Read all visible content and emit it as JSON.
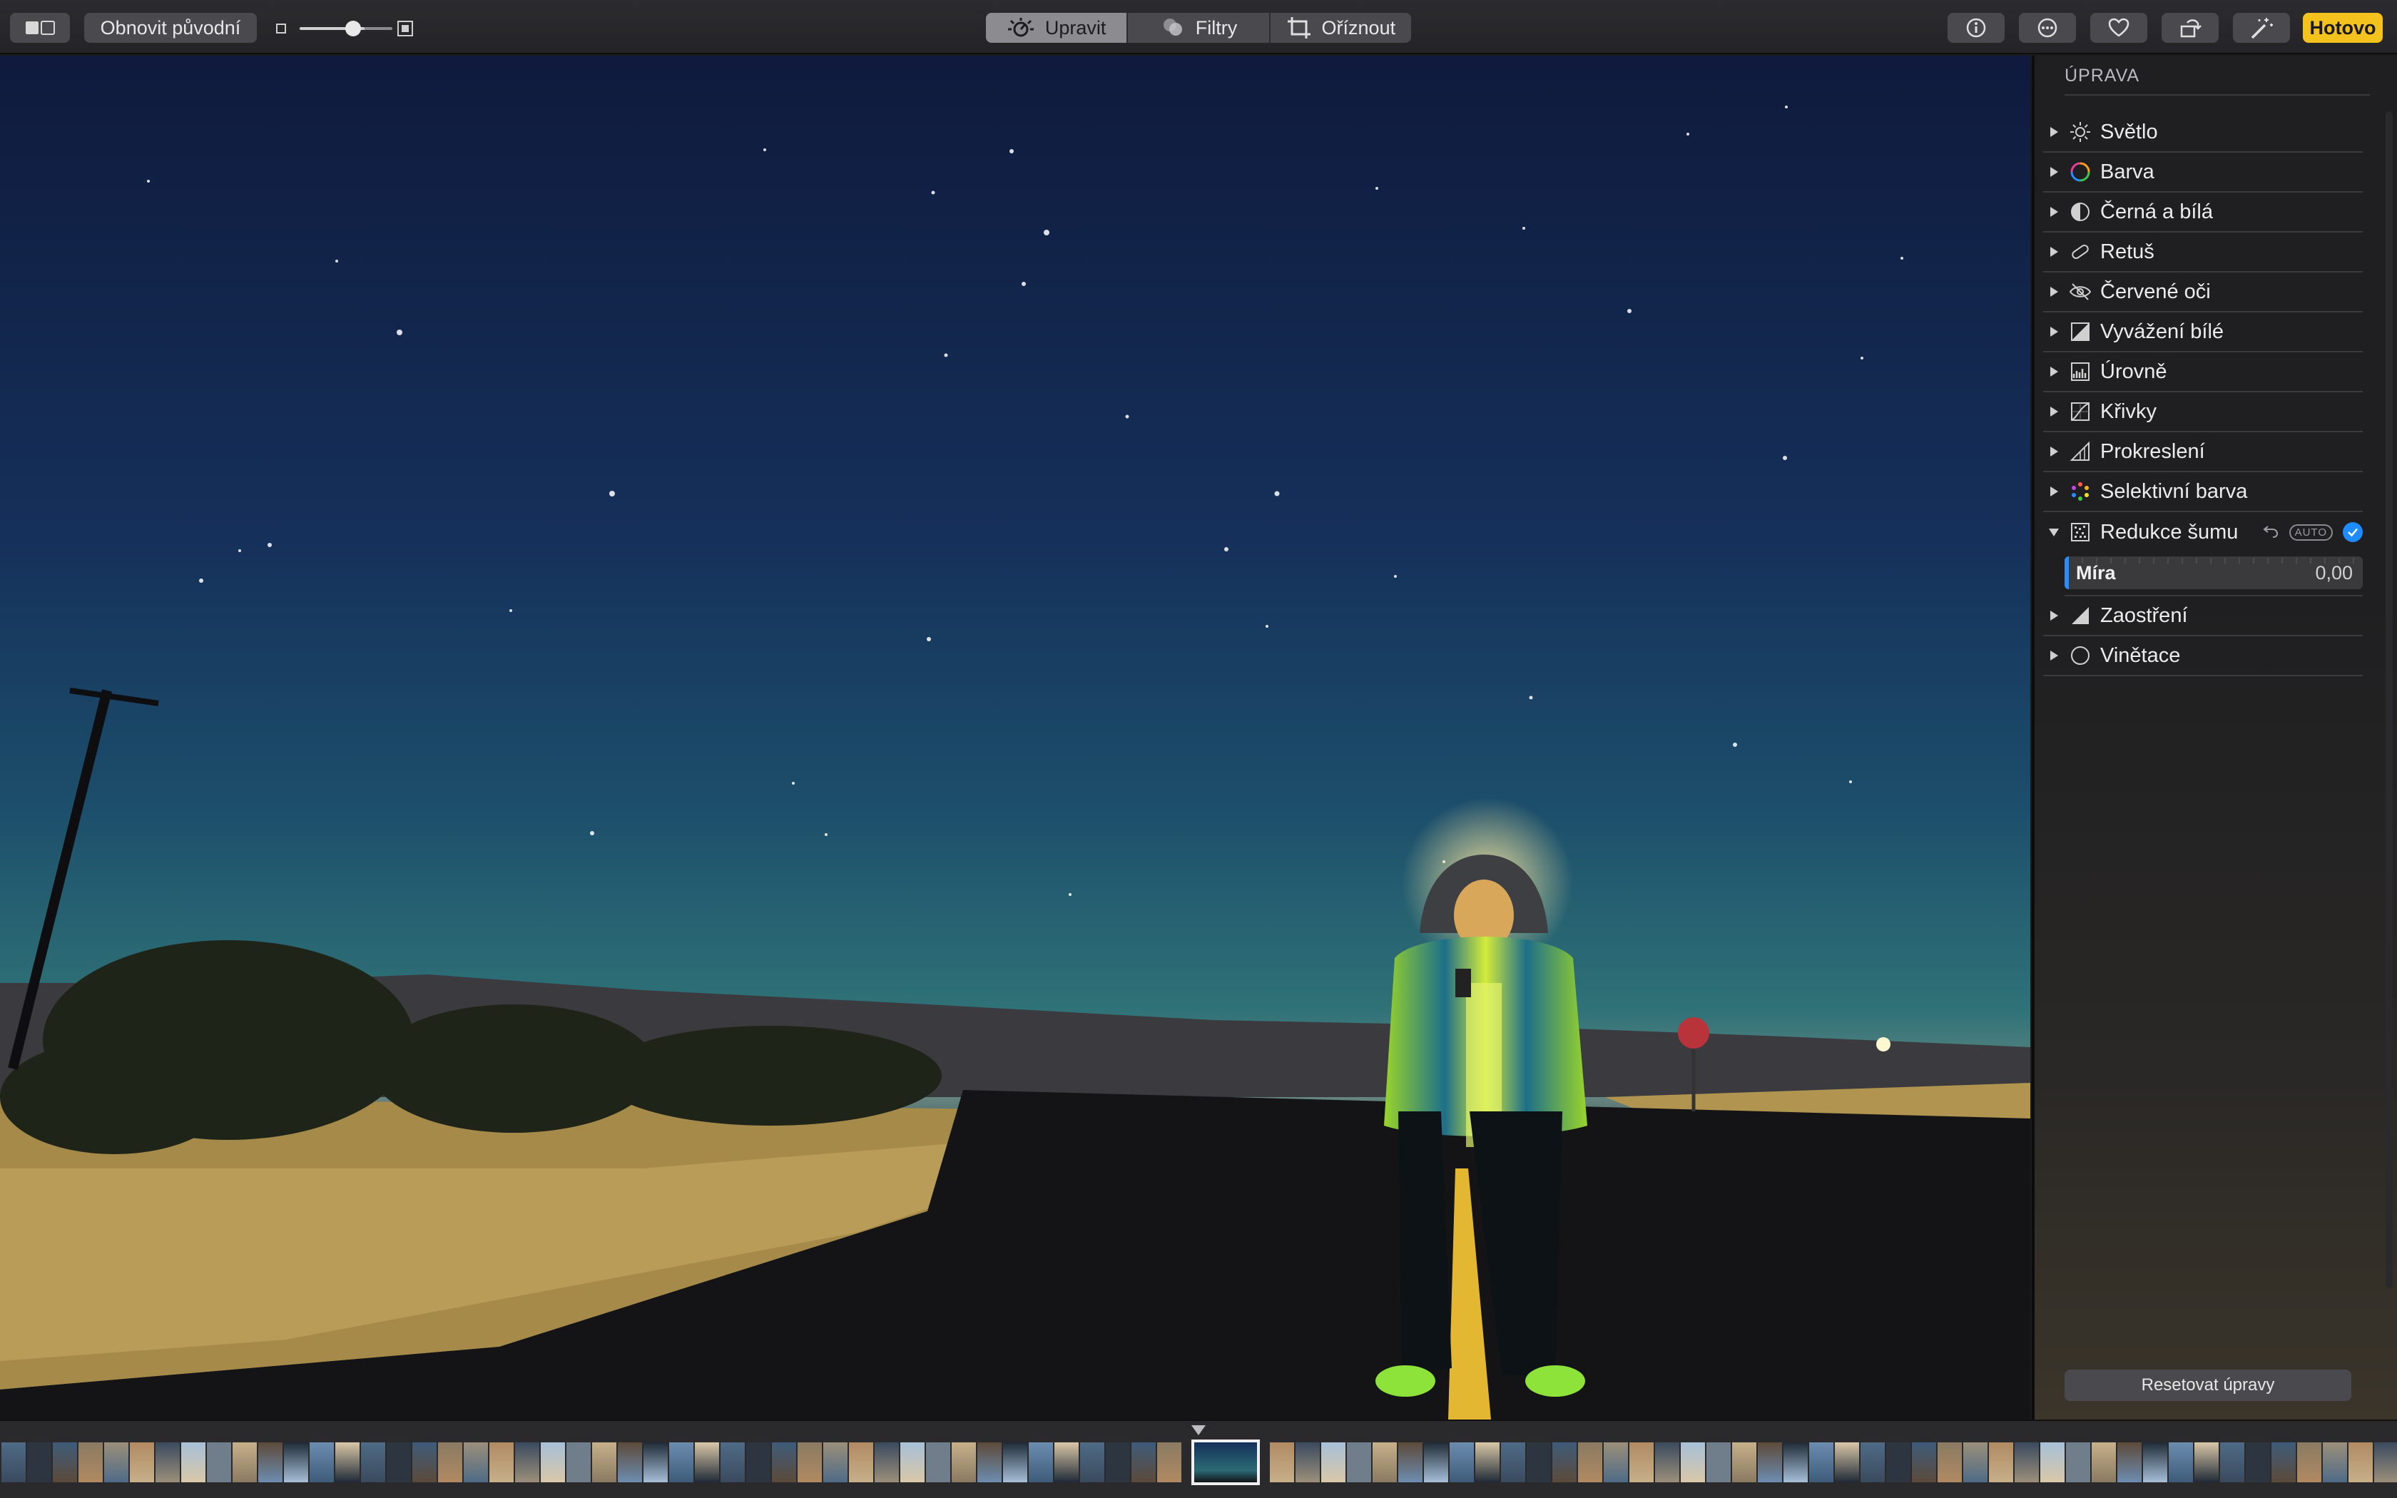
{
  "toolbar": {
    "revert_label": "Obnovit původní",
    "tabs": [
      {
        "label": "Upravit",
        "icon": "adjust-icon",
        "active": true
      },
      {
        "label": "Filtry",
        "icon": "filters-icon",
        "active": false
      },
      {
        "label": "Oříznout",
        "icon": "crop-icon",
        "active": false
      }
    ],
    "done_label": "Hotovo",
    "zoom_level": 0.7,
    "right_icons": [
      "info-icon",
      "more-icon",
      "heart-icon",
      "rotate-icon",
      "magic-wand-icon"
    ]
  },
  "sidebar": {
    "title": "ÚPRAVA",
    "sections": [
      {
        "label": "Světlo",
        "icon": "sun-icon",
        "expanded": false
      },
      {
        "label": "Barva",
        "icon": "color-circle-icon",
        "expanded": false
      },
      {
        "label": "Černá a bílá",
        "icon": "half-circle-icon",
        "expanded": false
      },
      {
        "label": "Retuš",
        "icon": "bandage-icon",
        "expanded": false
      },
      {
        "label": "Červené oči",
        "icon": "red-eye-icon",
        "expanded": false
      },
      {
        "label": "Vyvážení bílé",
        "icon": "white-balance-icon",
        "expanded": false
      },
      {
        "label": "Úrovně",
        "icon": "levels-icon",
        "expanded": false
      },
      {
        "label": "Křivky",
        "icon": "curves-icon",
        "expanded": false
      },
      {
        "label": "Prokreslení",
        "icon": "definition-icon",
        "expanded": false
      },
      {
        "label": "Selektivní barva",
        "icon": "selective-color-icon",
        "expanded": false
      },
      {
        "label": "Redukce šumu",
        "icon": "noise-reduction-icon",
        "expanded": true,
        "auto_label": "AUTO",
        "slider": {
          "label": "Míra",
          "value": "0,00",
          "fraction": 0
        }
      },
      {
        "label": "Zaostření",
        "icon": "sharpen-icon",
        "expanded": false
      },
      {
        "label": "Vinětace",
        "icon": "vignette-icon",
        "expanded": false
      }
    ],
    "reset_label": "Resetovat úpravy"
  },
  "colors": {
    "accent": "#f4c21c",
    "check_blue": "#1e8bff",
    "toolbar_bg": "#2c2c2f"
  }
}
